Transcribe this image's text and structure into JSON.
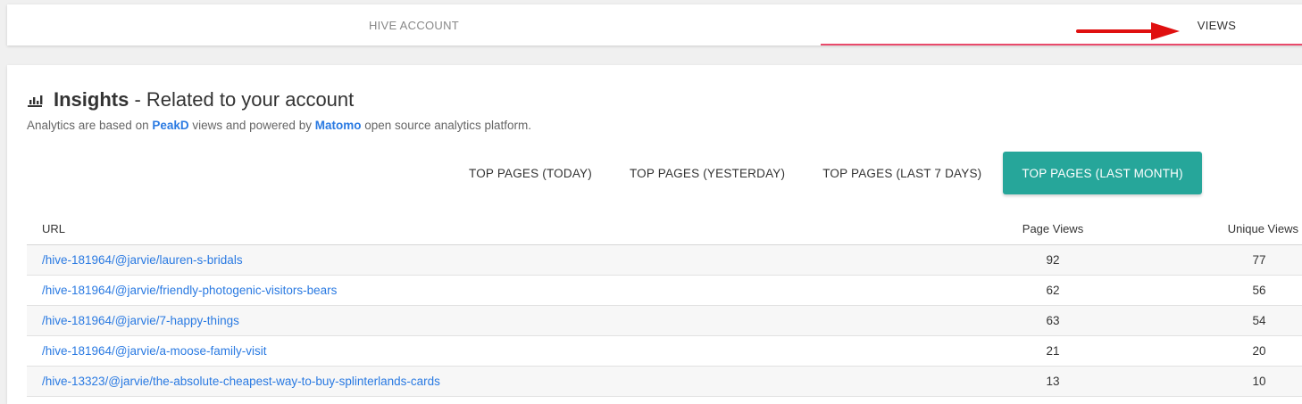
{
  "top_tabs": {
    "hive_account": "HIVE ACCOUNT",
    "views": "VIEWS"
  },
  "insights": {
    "title_bold": "Insights",
    "title_rest": " - Related to your account",
    "subtitle_pre": "Analytics are based on ",
    "subtitle_link1": "PeakD",
    "subtitle_mid": " views and powered by ",
    "subtitle_link2": "Matomo",
    "subtitle_post": " open source analytics platform."
  },
  "period_tabs": {
    "today": "TOP PAGES (TODAY)",
    "yesterday": "TOP PAGES (YESTERDAY)",
    "last7": "TOP PAGES (LAST 7 DAYS)",
    "last_month": "TOP PAGES (LAST MONTH)"
  },
  "table": {
    "headers": {
      "url": "URL",
      "page_views": "Page Views",
      "unique_views": "Unique Views"
    },
    "rows": [
      {
        "url": "/hive-181964/@jarvie/lauren-s-bridals",
        "page_views": "92",
        "unique_views": "77"
      },
      {
        "url": "/hive-181964/@jarvie/friendly-photogenic-visitors-bears",
        "page_views": "62",
        "unique_views": "56"
      },
      {
        "url": "/hive-181964/@jarvie/7-happy-things",
        "page_views": "63",
        "unique_views": "54"
      },
      {
        "url": "/hive-181964/@jarvie/a-moose-family-visit",
        "page_views": "21",
        "unique_views": "20"
      },
      {
        "url": "/hive-13323/@jarvie/the-absolute-cheapest-way-to-buy-splinterlands-cards",
        "page_views": "13",
        "unique_views": "10"
      }
    ]
  },
  "colors": {
    "accent_teal": "#26a69a",
    "tab_underline": "#e94a6b",
    "link_blue": "#2a7ae2",
    "arrow_red": "#e01010"
  }
}
